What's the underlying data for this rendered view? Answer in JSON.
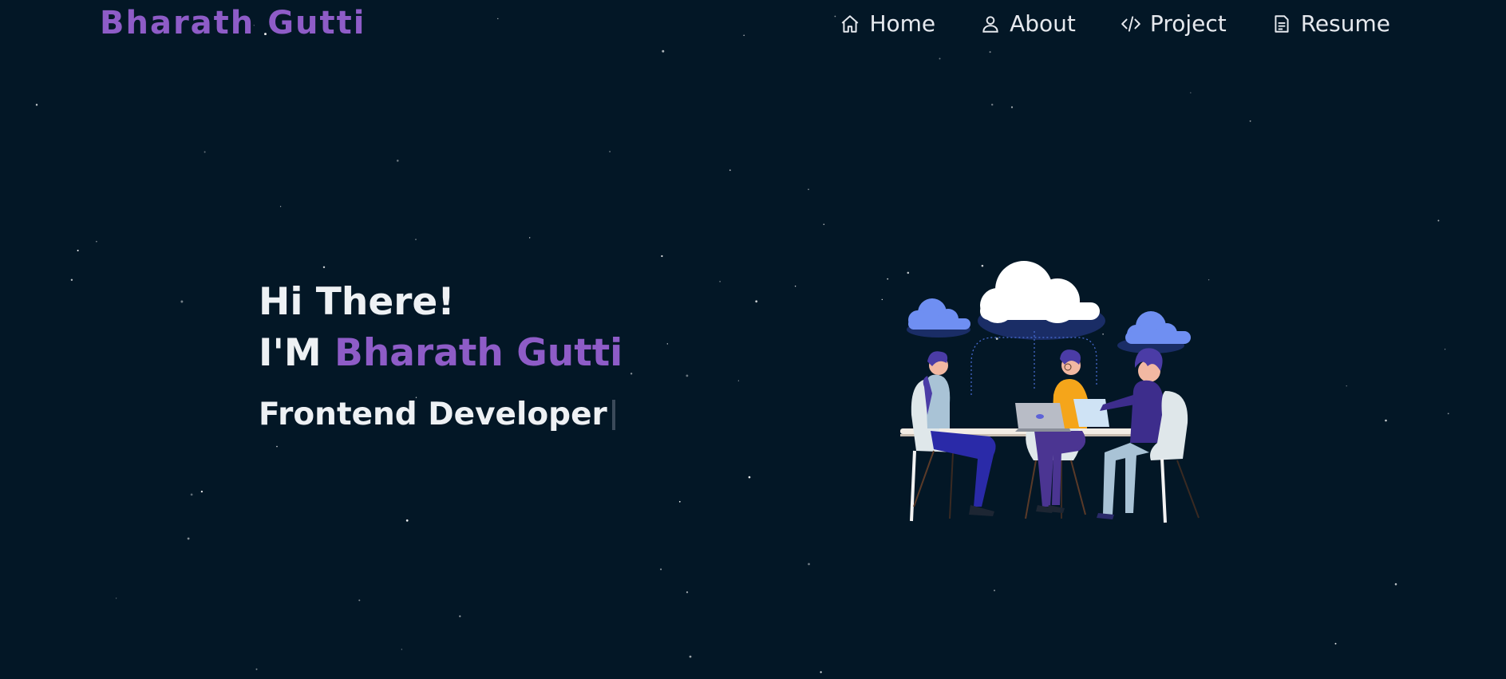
{
  "brand": {
    "name": "Bharath Gutti"
  },
  "nav": {
    "items": [
      {
        "label": "Home",
        "icon": "home-icon"
      },
      {
        "label": "About",
        "icon": "user-icon"
      },
      {
        "label": "Project",
        "icon": "code-icon"
      },
      {
        "label": "Resume",
        "icon": "document-icon"
      }
    ]
  },
  "hero": {
    "greeting": "Hi There!",
    "intro_prefix": "I'M",
    "intro_name": "Bharath Gutti",
    "role": "Frontend Developer"
  },
  "colors": {
    "background": "#031726",
    "accent": "#8e5cc7",
    "text": "#eef1f4"
  }
}
